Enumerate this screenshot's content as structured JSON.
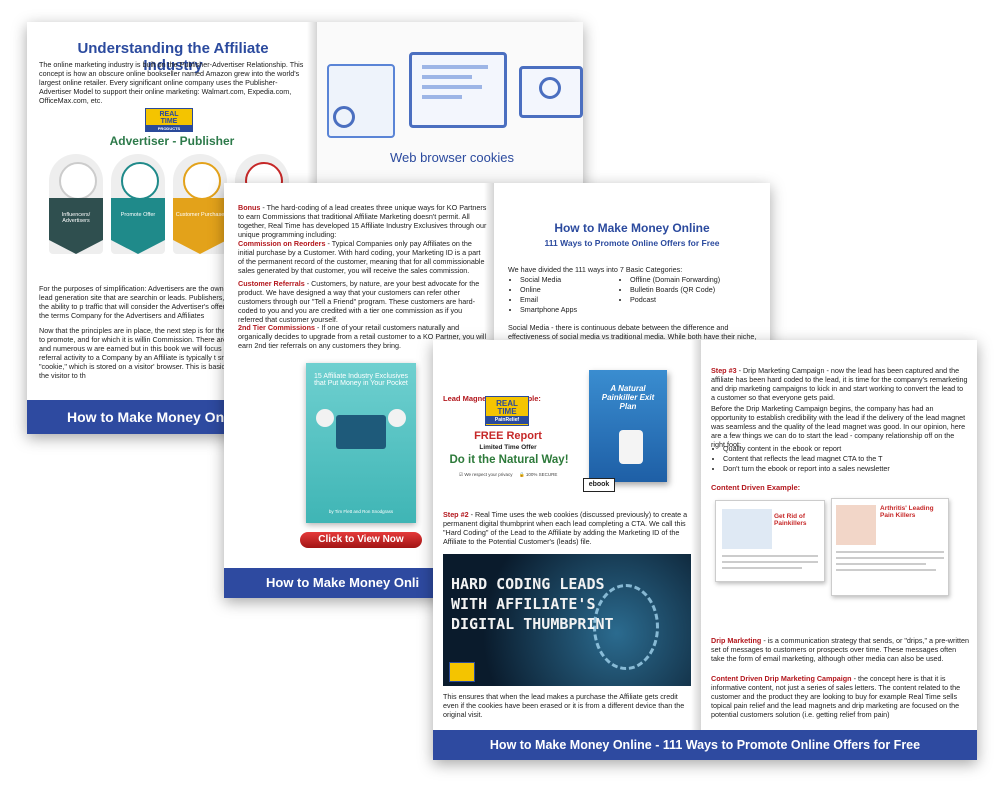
{
  "spread1": {
    "title": "Understanding the Affiliate Industry",
    "intro": "The online marketing industry is built on the Publisher-Advertiser Relationship. This concept is how an obscure online bookseller named Amazon grew into the world's largest online retailer. Every significant online company uses the Publisher-Advertiser Model to support their online marketing: Walmart.com, Expedia.com, OfficeMax.com, etc.",
    "logo_line1": "REAL",
    "logo_line2": "TIME",
    "logo_line3": "PRODUCTS",
    "diagram_title": "Advertiser - Publisher",
    "arrows": [
      {
        "label": "Influencers/ Advertisers",
        "color": "#2f4f4f"
      },
      {
        "label": "Promote Offer",
        "color": "#1f8a8a"
      },
      {
        "label": "Customer Purchase",
        "color": "#e3a21a"
      },
      {
        "label": "",
        "color": "#c62828"
      }
    ],
    "para2": "For the purposes of simplification: Advertisers are the owner ecommerce website or lead generation site that are searchin or leads. Publishers, on the other hand, have the ability to p traffic that will consider the Advertiser's offers. From this poi will use the terms Company for the Advertisers and Affiliates",
    "para3": "Now that the principles are in place, the next step is for the c an Offer for the Affiliate to promote, and for which it is willin Commission. There are many types of offers and numerous w are earned but in this book we will focus on a Sale triggering The referral activity to a Company by an Affiliate is typically t snippet of code called a \"cookie,\" which is stored on a visitor' browser. This is basically a record of who sent the visitor to th",
    "right_caption": "Web browser cookies",
    "footer": "How to Make Money Onli"
  },
  "spread2": {
    "bonus_label": "Bonus",
    "bonus_text": " - The hard-coding of a lead creates three unique ways for KO Partners to earn Commissions that traditional Affiliate Marketing doesn't permit. All together, Real Time has developed 15 Affiliate Industry Exclusives through our unique programming including:",
    "commission_label": "Commission on Reorders",
    "commission_text": " - Typical Companies only pay Affiliates on the initial purchase by a Customer. With hard coding, your Marketing ID is a part of the permanent record of the customer, meaning that for all commissionable sales generated by that customer, you will receive the sales commission.",
    "referrals_label": "Customer Referrals",
    "referrals_text": " - Customers, by nature, are your best advocate for the product. We have designed a way that your customers can refer other customers through our \"Tell a Friend\" program. These customers are hard-coded to you and you are credited with a tier one commission as if you referred that customer yourself.",
    "tier_label": "2nd Tier Commissions",
    "tier_text": " - If one of your retail customers naturally and organically decides to upgrade from a retail customer to a KO Partner, you will earn 2nd tier referrals on any customers they bring.",
    "book_title": "15 Affiliate Industry Exclusives that Put Money in Your Pocket",
    "book_authors": "by Tim Flett and Ron Snodgrass",
    "cta_button": "Click to View Now",
    "right_title": "How to Make Money Online",
    "right_subtitle": "111 Ways to Promote Online Offers for Free",
    "right_intro": "We have divided the 111 ways into 7 Basic Categories:",
    "categories_col1": [
      "Social Media",
      "Online",
      "Email",
      "Smartphone Apps"
    ],
    "categories_col2": [
      "Offline (Domain Forwarding)",
      "Bulletin Boards (QR Code)",
      "Podcast"
    ],
    "right_para": "Social Media - there is continuous debate between the difference and effectiveness of social media vs traditional media. While both have their niche, traditional media always has a price tag on it and this book is about FREE ways",
    "footer": "How to Make Money Onli"
  },
  "spread3": {
    "lead_magnet_label": "Lead Magnet CTA Example:",
    "rtp_line1": "REAL",
    "rtp_line2": "TIME",
    "rtp_line3": "PainRelief",
    "free_report": "FREE Report",
    "limited": "Limited Time Offer",
    "natural_way": "Do it the Natural Way!",
    "privacy": "We respect your privacy",
    "secure": "100% SECURE",
    "ebook_title": "A Natural Painkiller Exit Plan",
    "ebook_badge": "ebook",
    "step2_label": "Step #2",
    "step2_text": " - Real Time uses the web cookies (discussed previously) to create a permanent digital thumbprint when each lead completing a CTA. We call this \"Hard Coding\" of the Lead to the Affiliate by adding the Marketing ID of the Affiliate to the Potential Customer's (leads) file.",
    "thumb_text": "HARD CODING LEADS WITH AFFILIATE'S DIGITAL THUMBPRINT",
    "after_image": "This ensures that when the lead makes a purchase the Affiliate gets credit even if the cookies have been erased or it is from a different device than the original visit.",
    "step3_label": "Step #3",
    "step3_text": " - Drip Marketing Campaign - now the lead has been captured and the affiliate has been hard coded to the lead, it is time for the company's remarketing and drip marketing campaigns to kick in and start working to convert the lead to a customer so that everyone gets paid.",
    "step3_para": "Before the Drip Marketing Campaign begins, the company has had an opportunity to establish credibility with the lead if the delivery of the lead magnet was seamless and the quality of the lead magnet was good. In our opinion, here are a few things we can do to start the lead - company relationship off on the right foot:",
    "bullets": [
      "Quality content in the ebook or report",
      "Content that reflects the lead magnet CTA to the T",
      "Don't turn the ebook or report into a sales newsletter"
    ],
    "content_driven_label": "Content Driven Example:",
    "article1_title": "Get Rid of Painkillers",
    "article2_title": "Arthritis' Leading Pain Killers",
    "drip_label": "Drip Marketing",
    "drip_text": " - is a communication strategy that sends, or \"drips,\" a pre-written set of messages to customers or prospects over time. These messages often take the form of email marketing, although other media can also be used.",
    "cddm_label": "Content Driven Drip Marketing Campaign",
    "cddm_text": " - the concept here is that it is informative content, not just a series of sales letters. The content related to the customer and the product they are looking to buy for example Real Time sells topical pain relief and the lead magnets and drip marketing are focused on the potential customers solution (i.e. getting relief from pain)",
    "footer": "How to Make Money Online - 111 Ways to Promote Online Offers for Free"
  }
}
